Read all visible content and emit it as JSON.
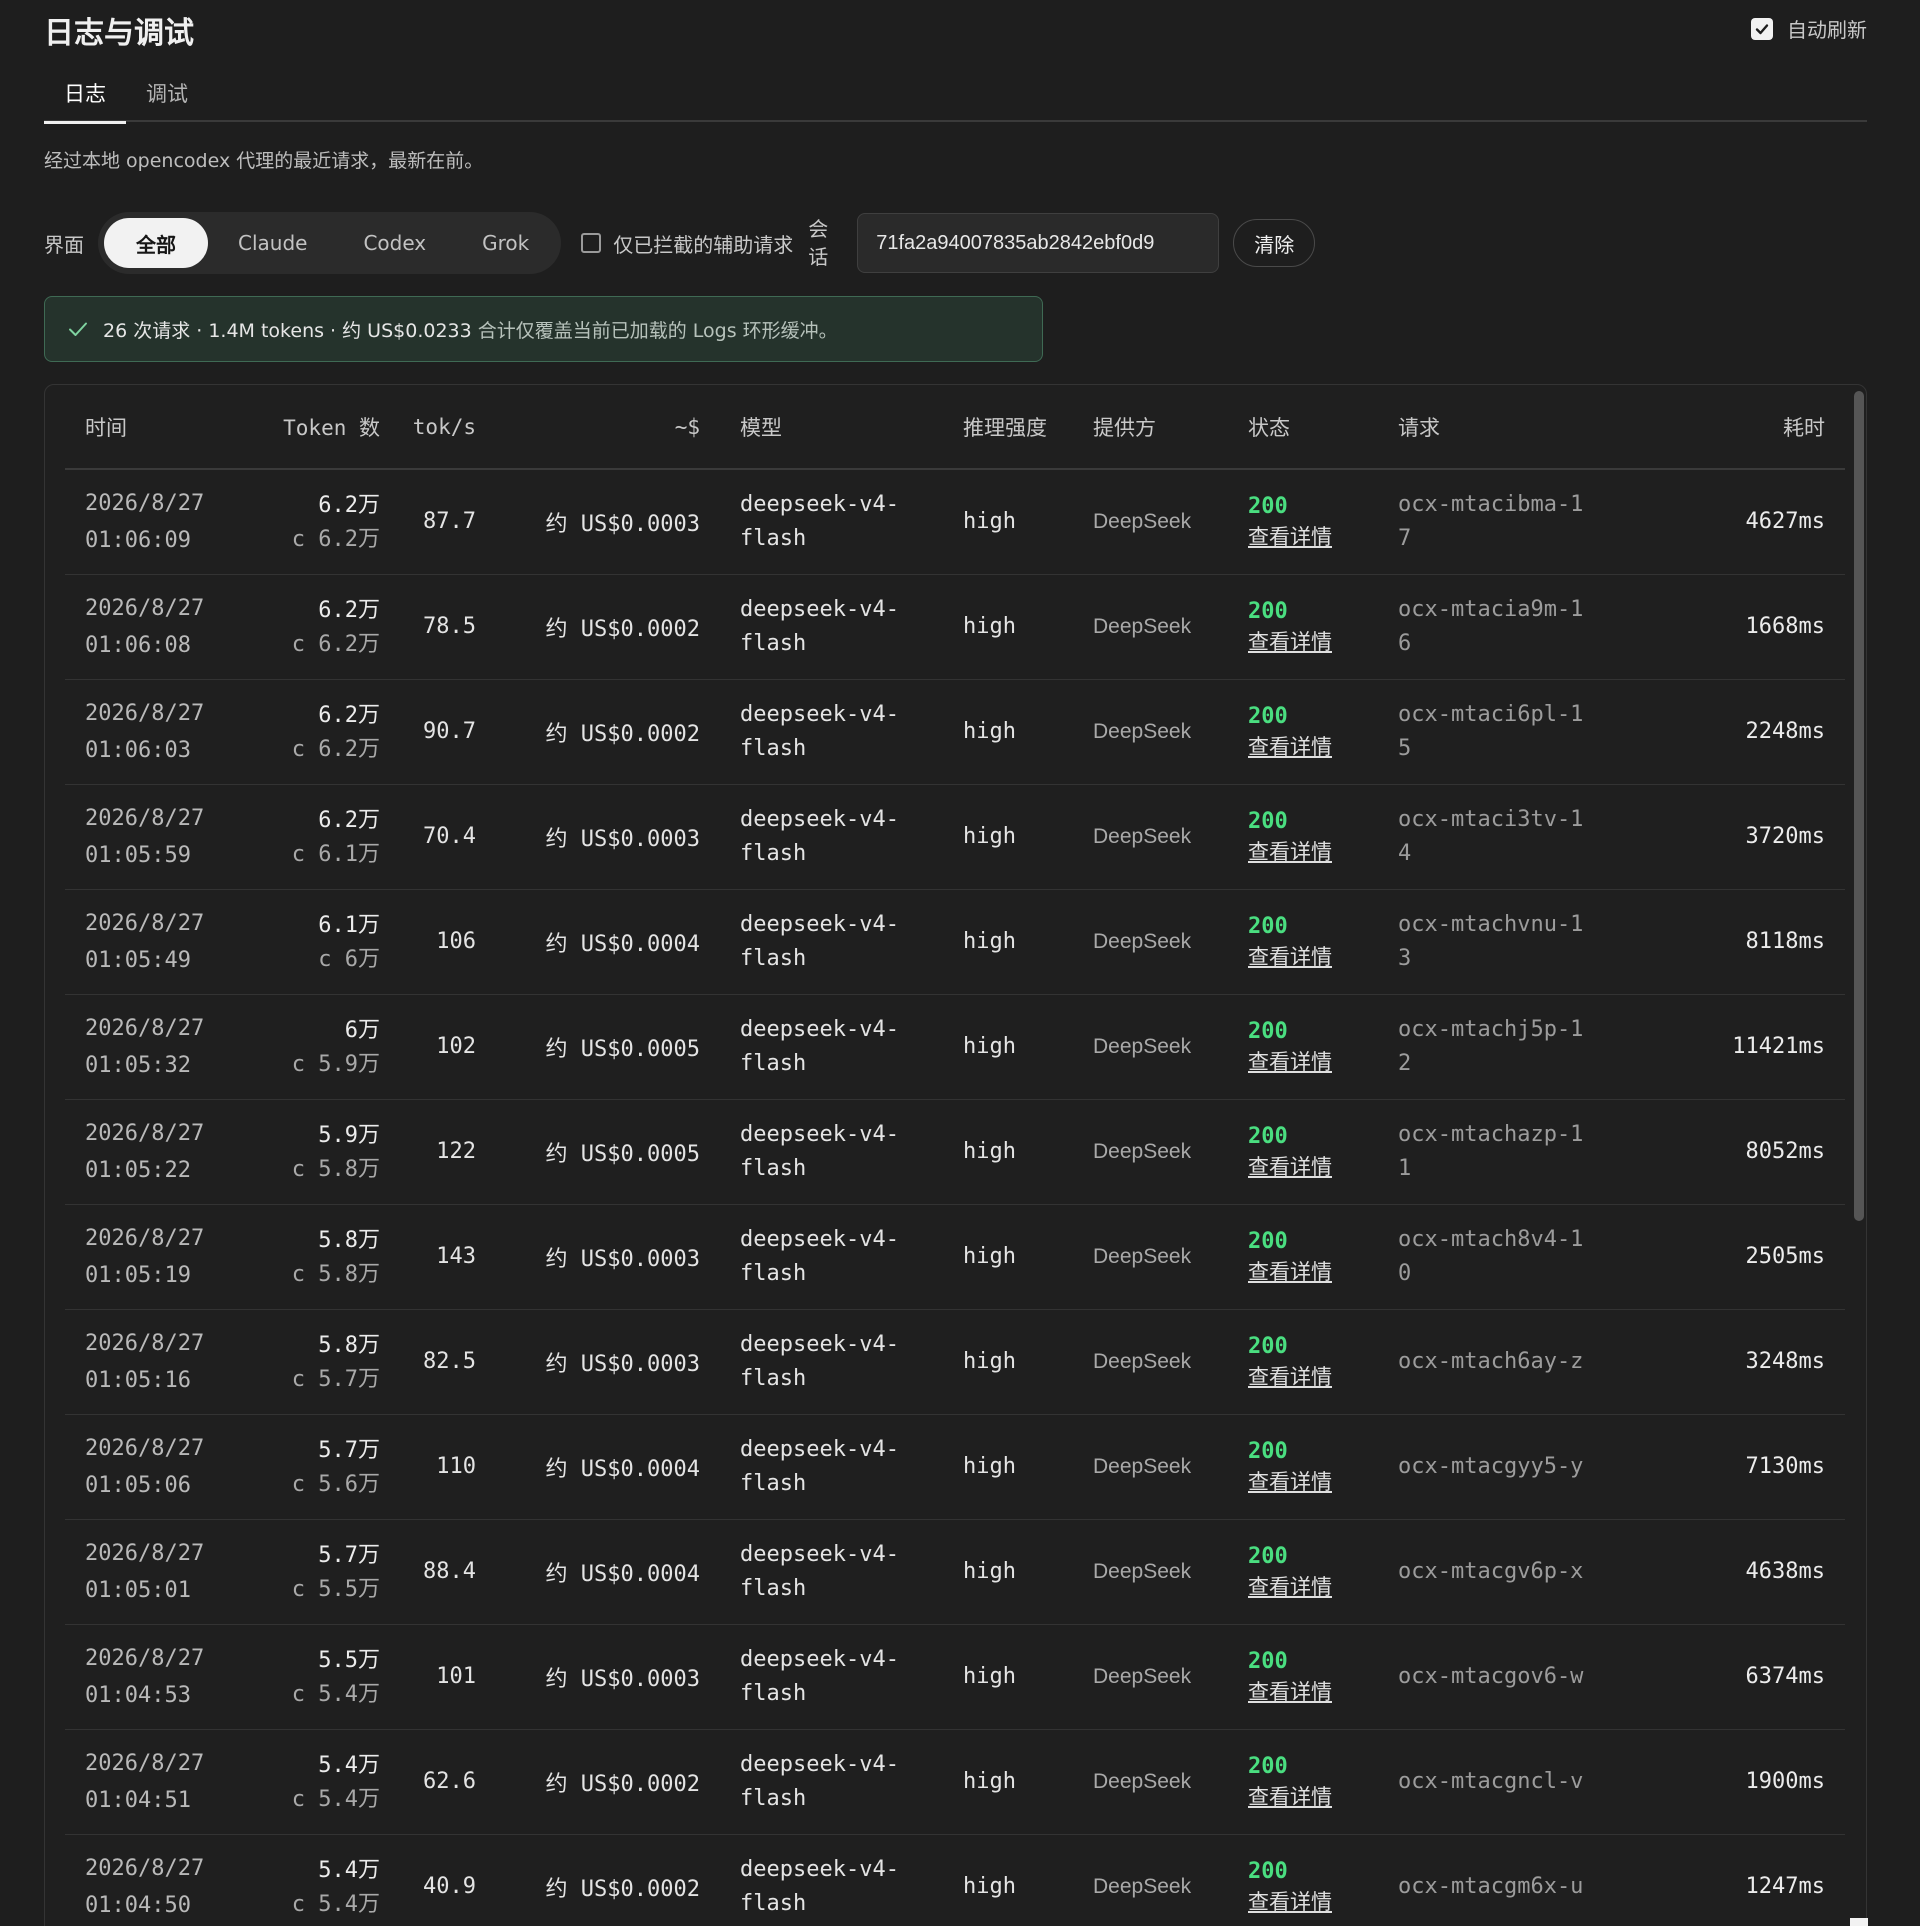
{
  "header": {
    "title": "日志与调试",
    "auto_refresh_label": "自动刷新"
  },
  "tabs": [
    {
      "label": "日志",
      "active": true
    },
    {
      "label": "调试",
      "active": false
    }
  ],
  "description": "经过本地 opencodex 代理的最近请求，最新在前。",
  "filters": {
    "surface_label": "界面",
    "segments": [
      "全部",
      "Claude",
      "Codex",
      "Grok"
    ],
    "intercept_label": "仅已拦截的辅助请求",
    "session_label_1": "会",
    "session_label_2": "话",
    "session_value": "71fa2a94007835ab2842ebf0d9",
    "clear_label": "清除"
  },
  "summary": {
    "main": "26 次请求 · 1.4M tokens · 约 US$0.0233",
    "note": "合计仅覆盖当前已加载的 Logs 环形缓冲。"
  },
  "table": {
    "headers": {
      "time": "时间",
      "tokens": "Token 数",
      "tps": "tok/s",
      "cost": "~$",
      "model": "模型",
      "effort": "推理强度",
      "provider": "提供方",
      "status": "状态",
      "request": "请求",
      "duration": "耗时"
    },
    "rows": [
      {
        "date": "2026/8/27",
        "time": "01:06:09",
        "tokens": "6.2万",
        "cached": "c 6.2万",
        "tps": "87.7",
        "cost": "约 US$0.0003",
        "model_1": "deepseek-v4-",
        "model_2": "flash",
        "effort": "high",
        "provider": "DeepSeek",
        "status": "200",
        "detail": "查看详情",
        "req_1": "ocx-mtacibma-1",
        "req_2": "7",
        "duration": "4627ms"
      },
      {
        "date": "2026/8/27",
        "time": "01:06:08",
        "tokens": "6.2万",
        "cached": "c 6.2万",
        "tps": "78.5",
        "cost": "约 US$0.0002",
        "model_1": "deepseek-v4-",
        "model_2": "flash",
        "effort": "high",
        "provider": "DeepSeek",
        "status": "200",
        "detail": "查看详情",
        "req_1": "ocx-mtacia9m-1",
        "req_2": "6",
        "duration": "1668ms"
      },
      {
        "date": "2026/8/27",
        "time": "01:06:03",
        "tokens": "6.2万",
        "cached": "c 6.2万",
        "tps": "90.7",
        "cost": "约 US$0.0002",
        "model_1": "deepseek-v4-",
        "model_2": "flash",
        "effort": "high",
        "provider": "DeepSeek",
        "status": "200",
        "detail": "查看详情",
        "req_1": "ocx-mtaci6pl-1",
        "req_2": "5",
        "duration": "2248ms"
      },
      {
        "date": "2026/8/27",
        "time": "01:05:59",
        "tokens": "6.2万",
        "cached": "c 6.1万",
        "tps": "70.4",
        "cost": "约 US$0.0003",
        "model_1": "deepseek-v4-",
        "model_2": "flash",
        "effort": "high",
        "provider": "DeepSeek",
        "status": "200",
        "detail": "查看详情",
        "req_1": "ocx-mtaci3tv-1",
        "req_2": "4",
        "duration": "3720ms"
      },
      {
        "date": "2026/8/27",
        "time": "01:05:49",
        "tokens": "6.1万",
        "cached": "c 6万",
        "tps": "106",
        "cost": "约 US$0.0004",
        "model_1": "deepseek-v4-",
        "model_2": "flash",
        "effort": "high",
        "provider": "DeepSeek",
        "status": "200",
        "detail": "查看详情",
        "req_1": "ocx-mtachvnu-1",
        "req_2": "3",
        "duration": "8118ms"
      },
      {
        "date": "2026/8/27",
        "time": "01:05:32",
        "tokens": "6万",
        "cached": "c 5.9万",
        "tps": "102",
        "cost": "约 US$0.0005",
        "model_1": "deepseek-v4-",
        "model_2": "flash",
        "effort": "high",
        "provider": "DeepSeek",
        "status": "200",
        "detail": "查看详情",
        "req_1": "ocx-mtachj5p-1",
        "req_2": "2",
        "duration": "11421ms"
      },
      {
        "date": "2026/8/27",
        "time": "01:05:22",
        "tokens": "5.9万",
        "cached": "c 5.8万",
        "tps": "122",
        "cost": "约 US$0.0005",
        "model_1": "deepseek-v4-",
        "model_2": "flash",
        "effort": "high",
        "provider": "DeepSeek",
        "status": "200",
        "detail": "查看详情",
        "req_1": "ocx-mtachazp-1",
        "req_2": "1",
        "duration": "8052ms"
      },
      {
        "date": "2026/8/27",
        "time": "01:05:19",
        "tokens": "5.8万",
        "cached": "c 5.8万",
        "tps": "143",
        "cost": "约 US$0.0003",
        "model_1": "deepseek-v4-",
        "model_2": "flash",
        "effort": "high",
        "provider": "DeepSeek",
        "status": "200",
        "detail": "查看详情",
        "req_1": "ocx-mtach8v4-1",
        "req_2": "0",
        "duration": "2505ms"
      },
      {
        "date": "2026/8/27",
        "time": "01:05:16",
        "tokens": "5.8万",
        "cached": "c 5.7万",
        "tps": "82.5",
        "cost": "约 US$0.0003",
        "model_1": "deepseek-v4-",
        "model_2": "flash",
        "effort": "high",
        "provider": "DeepSeek",
        "status": "200",
        "detail": "查看详情",
        "req_1": "ocx-mtach6ay-z",
        "req_2": "",
        "duration": "3248ms"
      },
      {
        "date": "2026/8/27",
        "time": "01:05:06",
        "tokens": "5.7万",
        "cached": "c 5.6万",
        "tps": "110",
        "cost": "约 US$0.0004",
        "model_1": "deepseek-v4-",
        "model_2": "flash",
        "effort": "high",
        "provider": "DeepSeek",
        "status": "200",
        "detail": "查看详情",
        "req_1": "ocx-mtacgyy5-y",
        "req_2": "",
        "duration": "7130ms"
      },
      {
        "date": "2026/8/27",
        "time": "01:05:01",
        "tokens": "5.7万",
        "cached": "c 5.5万",
        "tps": "88.4",
        "cost": "约 US$0.0004",
        "model_1": "deepseek-v4-",
        "model_2": "flash",
        "effort": "high",
        "provider": "DeepSeek",
        "status": "200",
        "detail": "查看详情",
        "req_1": "ocx-mtacgv6p-x",
        "req_2": "",
        "duration": "4638ms"
      },
      {
        "date": "2026/8/27",
        "time": "01:04:53",
        "tokens": "5.5万",
        "cached": "c 5.4万",
        "tps": "101",
        "cost": "约 US$0.0003",
        "model_1": "deepseek-v4-",
        "model_2": "flash",
        "effort": "high",
        "provider": "DeepSeek",
        "status": "200",
        "detail": "查看详情",
        "req_1": "ocx-mtacgov6-w",
        "req_2": "",
        "duration": "6374ms"
      },
      {
        "date": "2026/8/27",
        "time": "01:04:51",
        "tokens": "5.4万",
        "cached": "c 5.4万",
        "tps": "62.6",
        "cost": "约 US$0.0002",
        "model_1": "deepseek-v4-",
        "model_2": "flash",
        "effort": "high",
        "provider": "DeepSeek",
        "status": "200",
        "detail": "查看详情",
        "req_1": "ocx-mtacgncl-v",
        "req_2": "",
        "duration": "1900ms"
      },
      {
        "date": "2026/8/27",
        "time": "01:04:50",
        "tokens": "5.4万",
        "cached": "c 5.4万",
        "tps": "40.9",
        "cost": "约 US$0.0002",
        "model_1": "deepseek-v4-",
        "model_2": "flash",
        "effort": "high",
        "provider": "DeepSeek",
        "status": "200",
        "detail": "查看详情",
        "req_1": "ocx-mtacgm6x-u",
        "req_2": "",
        "duration": "1247ms"
      }
    ]
  },
  "colors": {
    "background": "#1e1e1e",
    "status_ok": "#4ade80",
    "summary_bg": "#25332c",
    "summary_border": "#3f6a54"
  }
}
